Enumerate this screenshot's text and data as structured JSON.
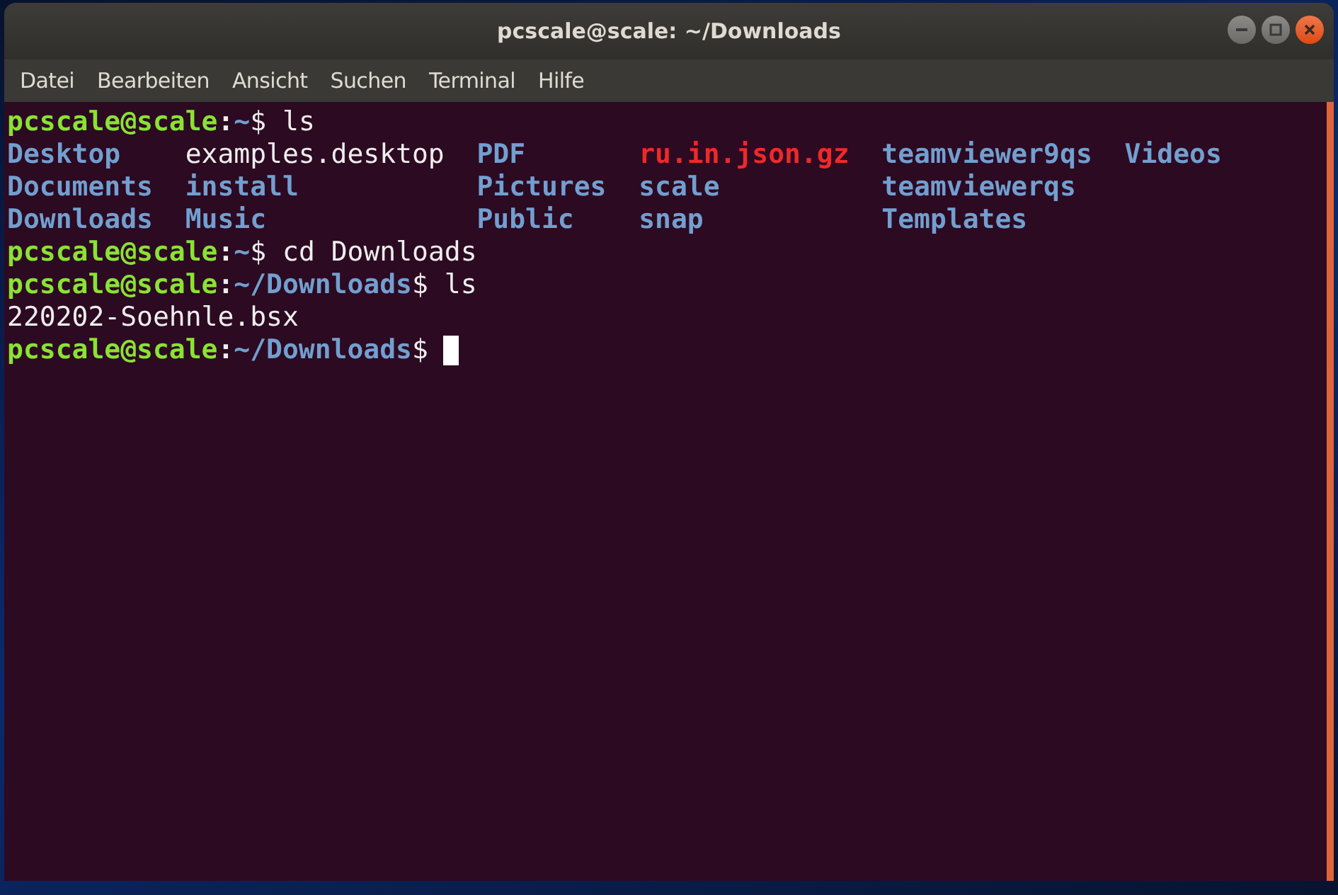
{
  "window": {
    "title": "pcscale@scale: ~/Downloads"
  },
  "menu": [
    "Datei",
    "Bearbeiten",
    "Ansicht",
    "Suchen",
    "Terminal",
    "Hilfe"
  ],
  "terminal": {
    "lines": [
      {
        "kind": "prompt",
        "user": "pcscale@scale",
        "separator": ":",
        "path": "~",
        "symbol": "$",
        "command": "ls",
        "cursor": false
      },
      {
        "kind": "listing",
        "columns": [
          [
            {
              "name": "Desktop",
              "kind": "dir"
            },
            {
              "name": "Documents",
              "kind": "dir"
            },
            {
              "name": "Downloads",
              "kind": "dir"
            }
          ],
          [
            {
              "name": "examples.desktop",
              "kind": "file"
            },
            {
              "name": "install",
              "kind": "dir"
            },
            {
              "name": "Music",
              "kind": "dir"
            }
          ],
          [
            {
              "name": "PDF",
              "kind": "dir"
            },
            {
              "name": "Pictures",
              "kind": "dir"
            },
            {
              "name": "Public",
              "kind": "dir"
            }
          ],
          [
            {
              "name": "ru.in.json.gz",
              "kind": "archive"
            },
            {
              "name": "scale",
              "kind": "dir"
            },
            {
              "name": "snap",
              "kind": "dir"
            }
          ],
          [
            {
              "name": "teamviewer9qs",
              "kind": "dir"
            },
            {
              "name": "teamviewerqs",
              "kind": "dir"
            },
            {
              "name": "Templates",
              "kind": "dir"
            }
          ],
          [
            {
              "name": "Videos",
              "kind": "dir"
            }
          ]
        ]
      },
      {
        "kind": "prompt",
        "user": "pcscale@scale",
        "separator": ":",
        "path": "~",
        "symbol": "$",
        "command": "cd Downloads",
        "cursor": false
      },
      {
        "kind": "prompt",
        "user": "pcscale@scale",
        "separator": ":",
        "path": "~/Downloads",
        "symbol": "$",
        "command": "ls",
        "cursor": false
      },
      {
        "kind": "output",
        "text": "220202-Soehnle.bsx"
      },
      {
        "kind": "prompt",
        "user": "pcscale@scale",
        "separator": ":",
        "path": "~/Downloads",
        "symbol": "$",
        "cursor": true
      }
    ]
  }
}
